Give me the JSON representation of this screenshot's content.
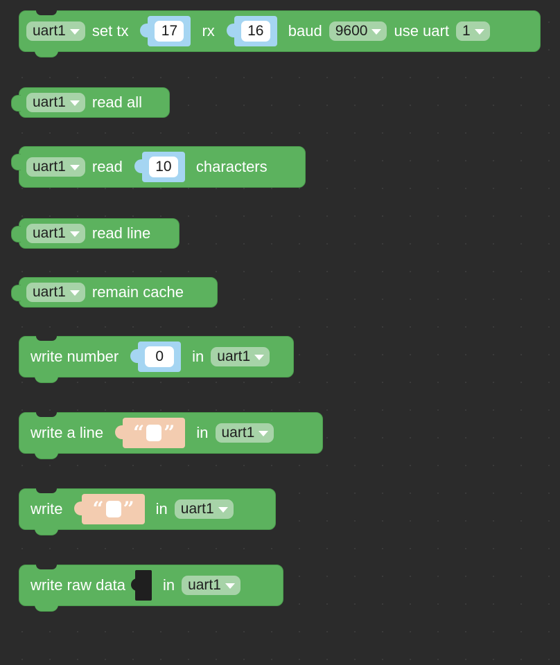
{
  "palette": {
    "workspace_bg": "#2b2b2b",
    "block_green": "#5cb25e",
    "dropdown_bg": "#a7d3a8",
    "number_slot": "#a5d5f2",
    "text_slot": "#f3ccb0",
    "empty_socket": "#1f1f1f"
  },
  "blocks": {
    "setup": {
      "uart_name": "uart1",
      "set_tx": "set tx",
      "tx_value": "17",
      "rx": "rx",
      "rx_value": "16",
      "baud": "baud",
      "baud_value": "9600",
      "use_uart": "use uart",
      "uart_index": "1"
    },
    "read_all": {
      "uart_name": "uart1",
      "label": "read all"
    },
    "read_chars": {
      "uart_name": "uart1",
      "read": "read",
      "count": "10",
      "characters": "characters"
    },
    "read_line": {
      "uart_name": "uart1",
      "label": "read line"
    },
    "remain_cache": {
      "uart_name": "uart1",
      "label": "remain cache"
    },
    "write_number": {
      "label": "write number",
      "value": "0",
      "in": "in",
      "uart_name": "uart1"
    },
    "write_line": {
      "label": "write a line",
      "open_quote": "“",
      "close_quote": "”",
      "in": "in",
      "uart_name": "uart1"
    },
    "write": {
      "label": "write",
      "open_quote": "“",
      "close_quote": "”",
      "in": "in",
      "uart_name": "uart1"
    },
    "write_raw": {
      "label": "write raw data",
      "in": "in",
      "uart_name": "uart1"
    }
  }
}
